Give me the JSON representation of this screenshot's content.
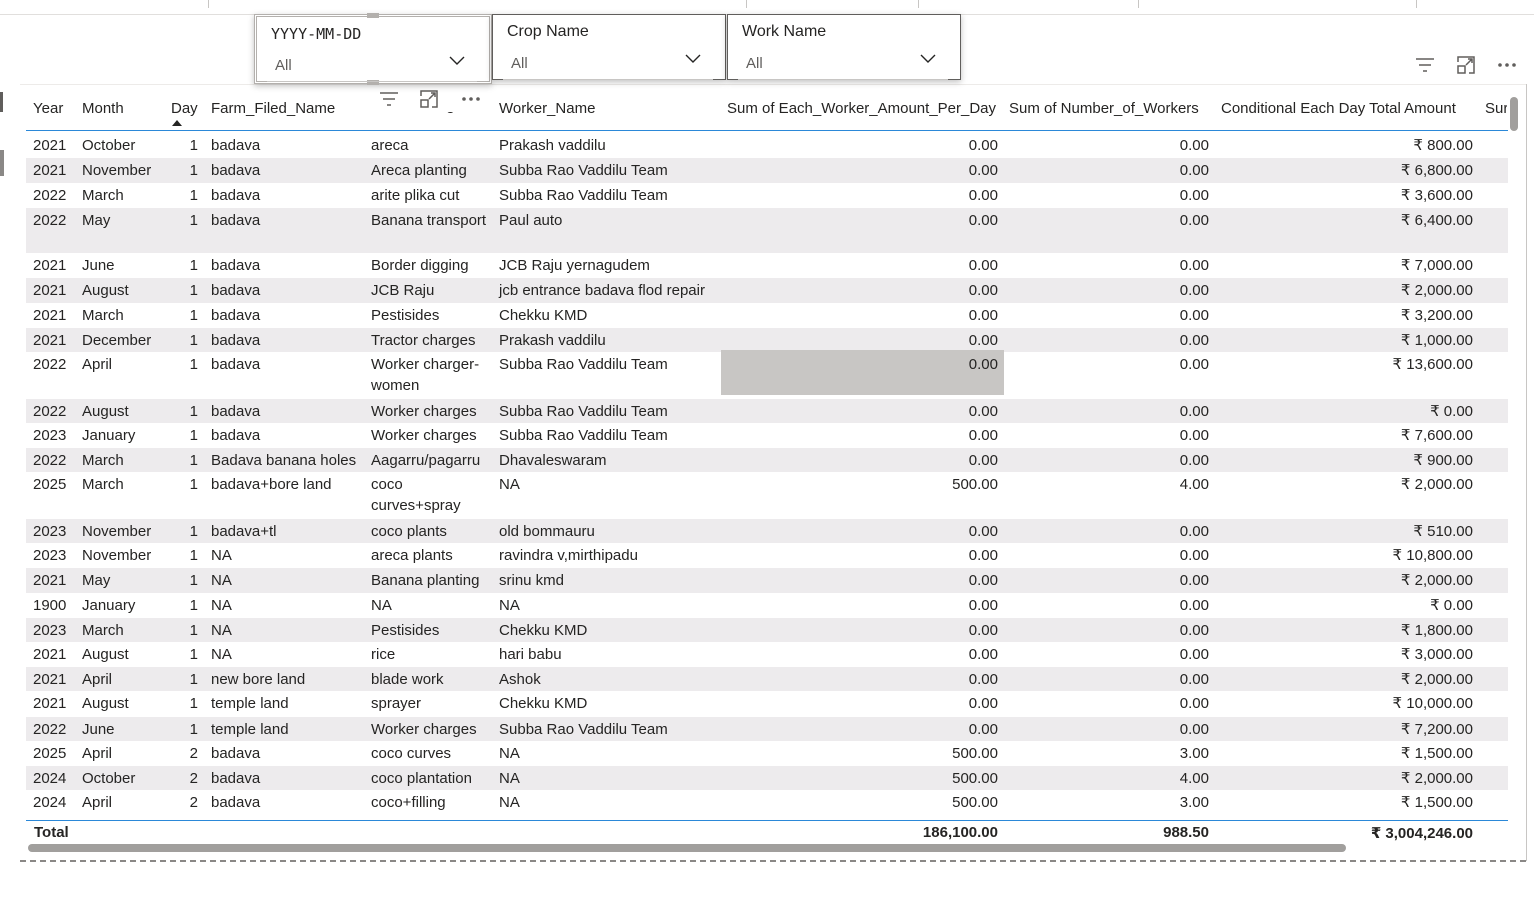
{
  "slicers": [
    {
      "title": "YYYY-MM-DD",
      "value": "All"
    },
    {
      "title": "Crop Name",
      "value": "All"
    },
    {
      "title": "Work Name",
      "value": "All"
    }
  ],
  "table": {
    "headers": [
      "Year",
      "Month",
      "Day",
      "Farm_Filed_Name",
      "Work_Name",
      "Worker_Name",
      "Sum of Each_Worker_Amount_Per_Day",
      "Sum of Number_of_Workers",
      "Conditional Each Day Total Amount",
      "Sur"
    ],
    "header_crop_visible": "e",
    "rows": [
      [
        "2021",
        "October",
        "1",
        "badava",
        "areca",
        "Prakash vaddilu",
        "0.00",
        "0.00",
        "₹ 800.00"
      ],
      [
        "2021",
        "November",
        "1",
        "badava",
        "Areca planting",
        "Subba Rao Vaddilu Team",
        "0.00",
        "0.00",
        "₹ 6,800.00"
      ],
      [
        "2022",
        "March",
        "1",
        "badava",
        "arite plika cut",
        "Subba Rao Vaddilu Team",
        "0.00",
        "0.00",
        "₹ 3,600.00"
      ],
      [
        "2022",
        "May",
        "1",
        "badava",
        "Banana transport",
        "Paul auto",
        "0.00",
        "0.00",
        "₹ 6,400.00"
      ],
      [
        "2021",
        "June",
        "1",
        "badava",
        "Border digging",
        "JCB Raju yernagudem",
        "0.00",
        "0.00",
        "₹ 7,000.00"
      ],
      [
        "2021",
        "August",
        "1",
        "badava",
        "JCB Raju",
        "jcb entrance badava flod repair",
        "0.00",
        "0.00",
        "₹ 2,000.00"
      ],
      [
        "2021",
        "March",
        "1",
        "badava",
        "Pestisides",
        "Chekku KMD",
        "0.00",
        "0.00",
        "₹ 3,200.00"
      ],
      [
        "2021",
        "December",
        "1",
        "badava",
        "Tractor charges",
        "Prakash vaddilu",
        "0.00",
        "0.00",
        "₹ 1,000.00"
      ],
      [
        "2022",
        "April",
        "1",
        "badava",
        "Worker charger-women",
        "Subba Rao Vaddilu Team",
        "0.00",
        "0.00",
        "₹ 13,600.00"
      ],
      [
        "2022",
        "August",
        "1",
        "badava",
        "Worker charges",
        "Subba Rao Vaddilu Team",
        "0.00",
        "0.00",
        "₹ 0.00"
      ],
      [
        "2023",
        "January",
        "1",
        "badava",
        "Worker charges",
        "Subba Rao Vaddilu Team",
        "0.00",
        "0.00",
        "₹ 7,600.00"
      ],
      [
        "2022",
        "March",
        "1",
        "Badava banana holes",
        "Aagarru/pagarru",
        "Dhavaleswaram",
        "0.00",
        "0.00",
        "₹ 900.00"
      ],
      [
        "2025",
        "March",
        "1",
        "badava+bore land",
        "coco curves+spray",
        "NA",
        "500.00",
        "4.00",
        "₹ 2,000.00"
      ],
      [
        "2023",
        "November",
        "1",
        "badava+tl",
        "coco plants",
        "old bommauru",
        "0.00",
        "0.00",
        "₹ 510.00"
      ],
      [
        "2023",
        "November",
        "1",
        "NA",
        "areca plants",
        "ravindra v,mirthipadu",
        "0.00",
        "0.00",
        "₹ 10,800.00"
      ],
      [
        "2021",
        "May",
        "1",
        "NA",
        "Banana planting",
        "srinu kmd",
        "0.00",
        "0.00",
        "₹ 2,000.00"
      ],
      [
        "1900",
        "January",
        "1",
        "NA",
        "NA",
        "NA",
        "0.00",
        "0.00",
        "₹ 0.00"
      ],
      [
        "2023",
        "March",
        "1",
        "NA",
        "Pestisides",
        "Chekku KMD",
        "0.00",
        "0.00",
        "₹ 1,800.00"
      ],
      [
        "2021",
        "August",
        "1",
        "NA",
        "rice",
        "hari babu",
        "0.00",
        "0.00",
        "₹ 3,000.00"
      ],
      [
        "2021",
        "April",
        "1",
        "new bore land",
        "blade work",
        "Ashok",
        "0.00",
        "0.00",
        "₹ 2,000.00"
      ],
      [
        "2021",
        "August",
        "1",
        "temple land",
        "sprayer",
        "Chekku KMD",
        "0.00",
        "0.00",
        "₹ 10,000.00"
      ],
      [
        "2022",
        "June",
        "1",
        "temple land",
        "Worker charges",
        "Subba Rao Vaddilu Team",
        "0.00",
        "0.00",
        "₹ 7,200.00"
      ],
      [
        "2025",
        "April",
        "2",
        "badava",
        "coco curves",
        "NA",
        "500.00",
        "3.00",
        "₹ 1,500.00"
      ],
      [
        "2024",
        "October",
        "2",
        "badava",
        "coco plantation",
        "NA",
        "500.00",
        "4.00",
        "₹ 2,000.00"
      ],
      [
        "2024",
        "April",
        "2",
        "badava",
        "coco+filling",
        "NA",
        "500.00",
        "3.00",
        "₹ 1,500.00"
      ]
    ],
    "total": {
      "label": "Total",
      "amount_per_day": "186,100.00",
      "workers": "988.50",
      "total_amount": "₹ 3,004,246.00"
    }
  },
  "icons": {
    "filter": "filter-icon",
    "focus": "focus-mode-icon",
    "more": "more-options-icon",
    "chevron": "chevron-down-icon"
  },
  "colors": {
    "accent": "#2b88d8",
    "alt_row": "#edebed",
    "highlight": "#c8c6c4"
  }
}
